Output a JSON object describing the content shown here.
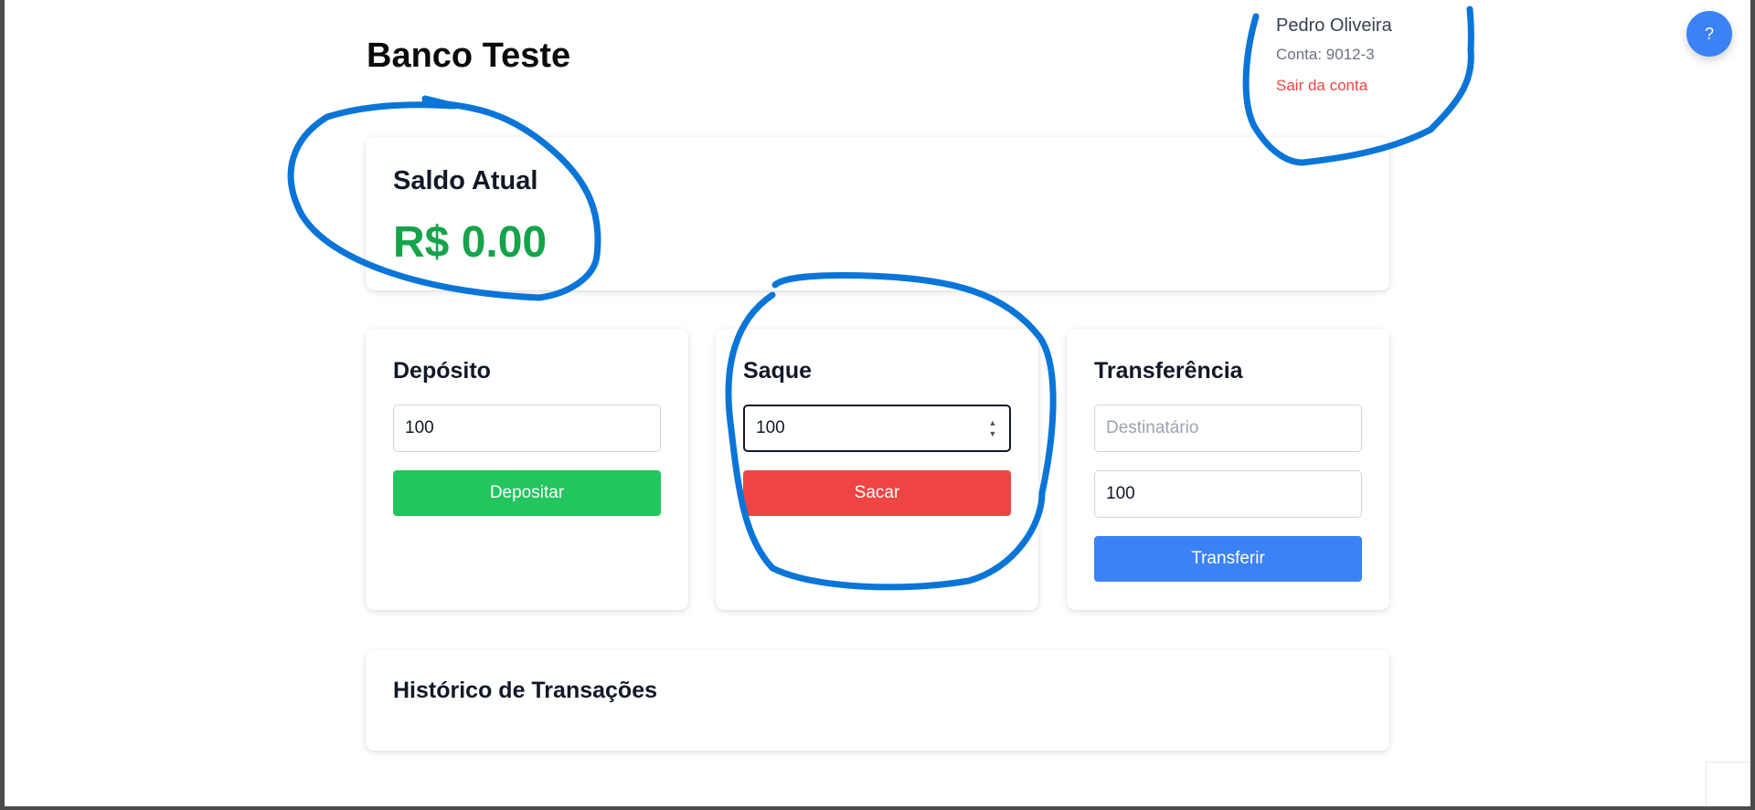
{
  "app": {
    "title": "Banco Teste"
  },
  "user": {
    "name": "Pedro Oliveira",
    "account": "Conta: 9012-3",
    "logout_label": "Sair da conta"
  },
  "help": {
    "label": "?"
  },
  "balance": {
    "label": "Saldo Atual",
    "value": "R$ 0.00",
    "color": "#16a34a"
  },
  "deposit": {
    "title": "Depósito",
    "amount_value": "100",
    "button_label": "Depositar",
    "button_color": "#22c55e"
  },
  "withdraw": {
    "title": "Saque",
    "amount_value": "100",
    "button_label": "Sacar",
    "button_color": "#ef4444"
  },
  "transfer": {
    "title": "Transferência",
    "recipient_placeholder": "Destinatário",
    "recipient_value": "",
    "amount_value": "100",
    "button_label": "Transferir",
    "button_color": "#3b82f6"
  },
  "history": {
    "title": "Histórico de Transações"
  },
  "annotation": {
    "color": "#0a75d8"
  },
  "icons": {
    "spin_up": "chevron-up-icon",
    "spin_down": "chevron-down-icon"
  }
}
